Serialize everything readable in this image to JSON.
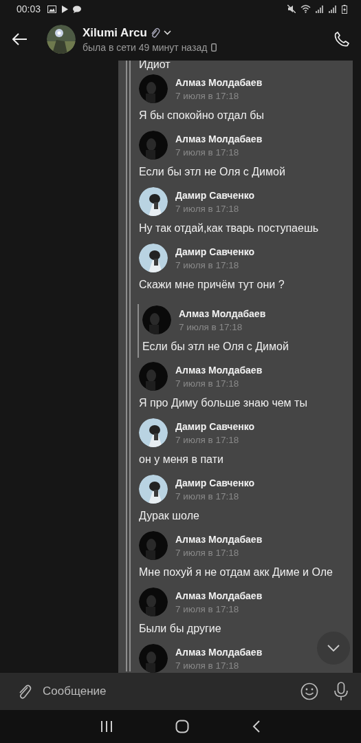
{
  "status_bar": {
    "time": "00:03"
  },
  "header": {
    "name": "Xilumi Arcu",
    "status": "была в сети 49 минут назад"
  },
  "top_text": "Идиот",
  "messages": [
    {
      "author": "Алмаз Молдабаев",
      "kind": "dark",
      "date": "7 июля в 17:18",
      "text": "Я бы спокойно отдал бы",
      "nested": false
    },
    {
      "author": "Алмаз Молдабаев",
      "kind": "dark",
      "date": "7 июля в 17:18",
      "text": "Если бы этл не Оля с Димой",
      "nested": false
    },
    {
      "author": "Дамир Савченко",
      "kind": "light",
      "date": "7 июля в 17:18",
      "text": "Ну так отдай,как тварь поступаешь",
      "nested": false
    },
    {
      "author": "Дамир Савченко",
      "kind": "light",
      "date": "7 июля в 17:18",
      "text": "Скажи мне причём тут они ?",
      "nested": false
    },
    {
      "author": "Алмаз Молдабаев",
      "kind": "dark",
      "date": "7 июля в 17:18",
      "text": "Если бы этл не Оля с Димой",
      "nested": true
    },
    {
      "author": "Алмаз Молдабаев",
      "kind": "dark",
      "date": "7 июля в 17:18",
      "text": "Я про Диму больше знаю чем ты",
      "nested": false
    },
    {
      "author": "Дамир Савченко",
      "kind": "light",
      "date": "7 июля в 17:18",
      "text": "он у меня в пати",
      "nested": false
    },
    {
      "author": "Дамир Савченко",
      "kind": "light",
      "date": "7 июля в 17:18",
      "text": "Дурак шоле",
      "nested": false
    },
    {
      "author": "Алмаз Молдабаев",
      "kind": "dark",
      "date": "7 июля в 17:18",
      "text": "Мне похуй я не отдам акк Диме и Оле",
      "nested": false
    },
    {
      "author": "Алмаз Молдабаев",
      "kind": "dark",
      "date": "7 июля в 17:18",
      "text": "Были бы другие",
      "nested": false
    },
    {
      "author": "Алмаз Молдабаев",
      "kind": "dark",
      "date": "7 июля в 17:18",
      "nested": false
    }
  ],
  "composer": {
    "placeholder": "Сообщение"
  }
}
